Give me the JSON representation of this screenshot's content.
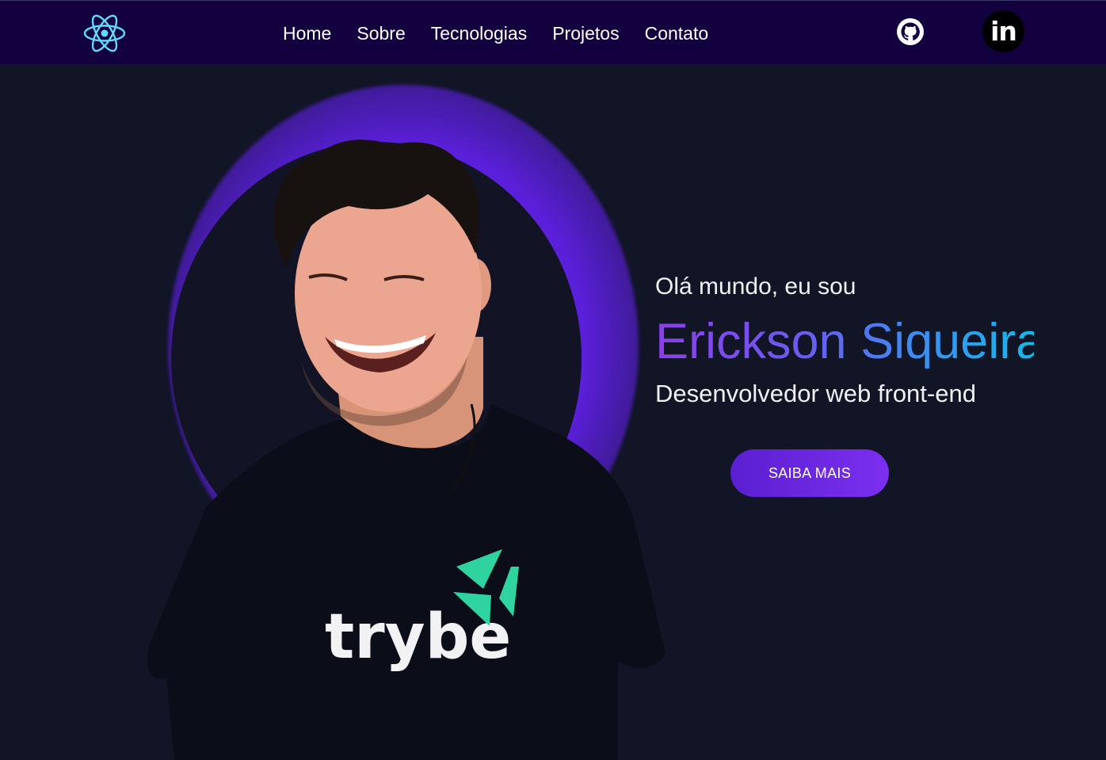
{
  "nav": {
    "logo_icon": "react-atom-icon",
    "links": [
      "Home",
      "Sobre",
      "Tecnologias",
      "Projetos",
      "Contato"
    ],
    "social": [
      {
        "icon": "github-icon"
      },
      {
        "icon": "linkedin-icon",
        "glyph": "in"
      }
    ],
    "colors": {
      "bar": "#13003f",
      "link": "#ffffff",
      "logo": "#61dafb"
    }
  },
  "hero": {
    "greeting": "Olá mundo, eu sou",
    "name": "Erickson Siqueira",
    "role": "Desenvolvedor web front-end",
    "cta_label": "SAIBA MAIS",
    "shirt_brand": "trybe",
    "colors": {
      "background": "#111526",
      "halo": "#5a1fd8",
      "name_gradient": [
        "#8b3ee8",
        "#3b8ef0",
        "#18b8e8"
      ],
      "cta": "#6a28e6"
    }
  }
}
